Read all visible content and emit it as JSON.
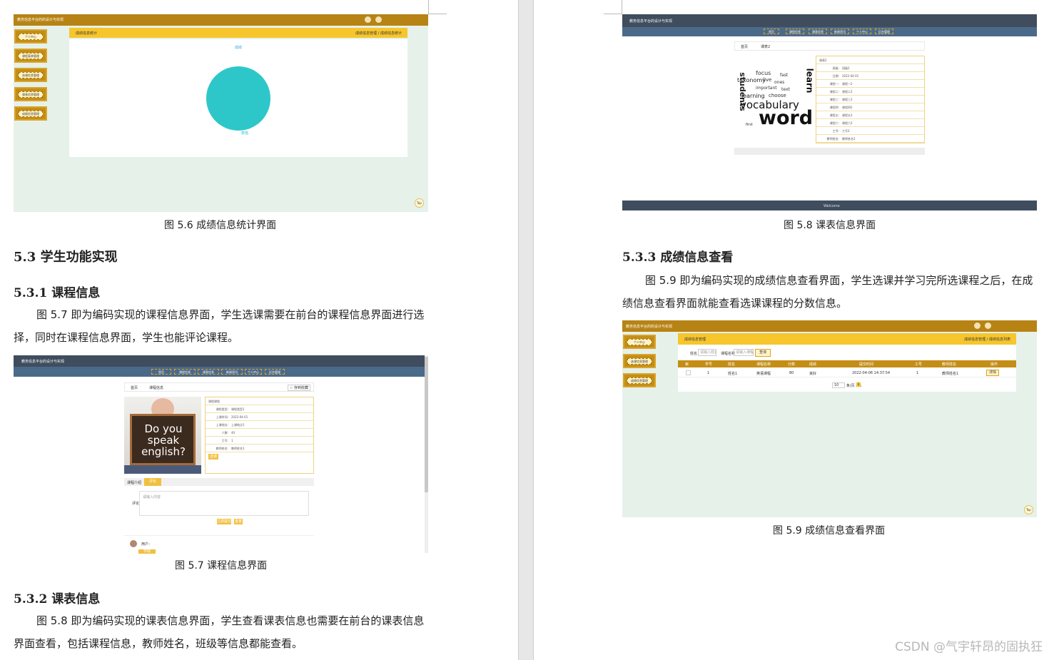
{
  "left_page": {
    "fig56": {
      "app_title": "教务信息平台的的设计与实现",
      "side_menu": [
        "个人中心",
        "课程菜单管理",
        "选课信息管理",
        "课表信息管理",
        "成绩信息管理"
      ],
      "breadcrumb_left": "成绩信息统计",
      "breadcrumb_right": "成绩信息管理 / 成绩信息统计",
      "chart_title": "成绩",
      "legend_label": "数值",
      "top_button": "Top"
    },
    "caption_56": "图 5.6  成绩信息统计界面",
    "h_53": "5.3  学生功能实现",
    "h_531": "5.3.1  课程信息",
    "para_531": "图 5.7 即为编码实现的课程信息界面，学生选课需要在前台的课程信息界面进行选择，同时在课程信息界面，学生也能评论课程。",
    "fig57": {
      "app_title": "教务信息平台的设计与实现",
      "nav": [
        "首页",
        "课程信息",
        "课表信息",
        "新闻资讯",
        "个人中心",
        "后台管理"
      ],
      "breadcrumb_home": "首页",
      "breadcrumb_current": "课程信息",
      "favorite_button": "☆ 存到收藏",
      "photo_text": "Do you speak english?",
      "form_title": "课程课程",
      "form_rows": [
        {
          "k": "课程类型:",
          "v": "课程类型1"
        },
        {
          "k": "上课时间:",
          "v": "2022-04-01"
        },
        {
          "k": "上课地点:",
          "v": "上课地点1"
        },
        {
          "k": "人数:",
          "v": "40"
        },
        {
          "k": "工号:",
          "v": "1"
        },
        {
          "k": "教师姓名:",
          "v": "教师姓名1"
        }
      ],
      "select_button": "选课",
      "tab_intro": "课程介绍",
      "tab_comment": "评论",
      "comment_label": "评论",
      "comment_placeholder": "请输入内容",
      "submit_button": "立即提交",
      "reset_button": "重置",
      "commenter": "用户：",
      "reply_button": "学院"
    },
    "caption_57": "图 5.7  课程信息界面",
    "h_532": "5.3.2  课表信息",
    "para_532": "图 5.8 即为编码实现的课表信息界面，学生查看课表信息也需要在前台的课表信息界面查看，包括课程信息，教师姓名，班级等信息都能查看。"
  },
  "right_page": {
    "fig58": {
      "app_title": "教务信息平台的设计与实现",
      "nav": [
        "首页",
        "课程信息",
        "课表信息",
        "新闻资讯",
        "个人中心",
        "后台管理"
      ],
      "breadcrumb_home": "首页",
      "breadcrumb_current": "课表2",
      "form_title": "课表2",
      "form_rows": [
        {
          "k": "班级:",
          "v": "班级2"
        },
        {
          "k": "日期:",
          "v": "2022-04-01"
        },
        {
          "k": "课程一:",
          "v": "课程一2"
        },
        {
          "k": "课程二:",
          "v": "课程二2"
        },
        {
          "k": "课程三:",
          "v": "课程三2"
        },
        {
          "k": "课程四:",
          "v": "课程四2"
        },
        {
          "k": "课程五:",
          "v": "课程五2"
        },
        {
          "k": "课程六:",
          "v": "课程六2"
        },
        {
          "k": "工号:",
          "v": "工号2"
        },
        {
          "k": "教师姓名:",
          "v": "教师姓名2"
        }
      ],
      "wordcloud_big": "word",
      "wordcloud_mid": "vocabulary",
      "wordcloud_small": [
        "students",
        "learn",
        "taxonomy",
        "focus",
        "important",
        "learning",
        "choose",
        "live",
        "ones",
        "fast",
        "text",
        "first"
      ],
      "footer_text": "Welcome"
    },
    "caption_58": "图 5.8  课表信息界面",
    "h_533": "5.3.3  成绩信息查看",
    "para_533": "图 5.9 即为编码实现的成绩信息查看界面，学生选课并学习完所选课程之后，在成绩信息查看界面就能查看选课课程的分数信息。",
    "fig59": {
      "app_title": "教务信息平台的的设计与实现",
      "side_menu": [
        "个人中心",
        "选课信息管理",
        "成绩信息管理"
      ],
      "breadcrumb_left": "成绩信息管理",
      "breadcrumb_right": "成绩信息管理 / 成绩信息列表",
      "search_label_1": "姓名",
      "search_placeholder_1": "请输入姓名",
      "search_label_2": "课程名称",
      "search_placeholder_2": "请输入课程名",
      "search_button": "查询",
      "table_headers": [
        "索",
        "学号",
        "姓名",
        "课程名称",
        "分数",
        "成绩",
        "提交时间",
        "工号",
        "教师姓名",
        "操作"
      ],
      "table_row": [
        "",
        "1",
        "姓名1",
        "英语课程",
        "80",
        "良好",
        "2022-04-06 14:37:54",
        "1",
        "教师姓名1",
        "详情"
      ],
      "pagination_size": "10",
      "pagination_text": "条/页 共1",
      "pagination_page": "1",
      "top_button": "Top"
    },
    "caption_59": "图 5.9  成绩信息查看界面",
    "watermark": "CSDN @气宇轩昂的固执狂"
  }
}
